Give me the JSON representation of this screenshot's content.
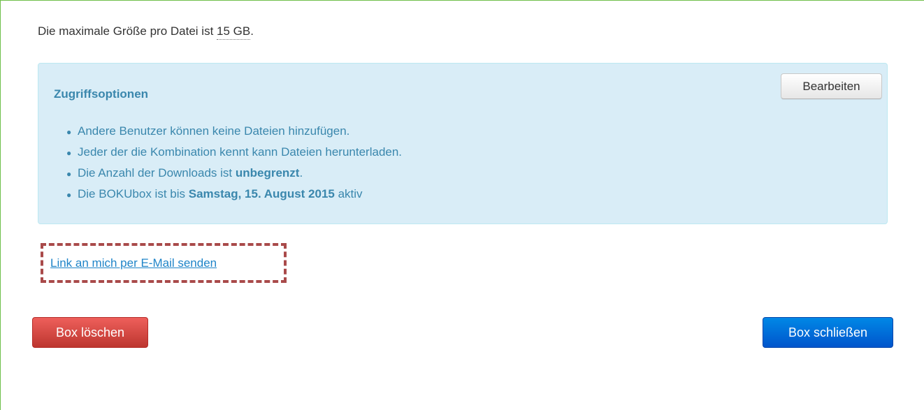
{
  "max_size": {
    "prefix": "Die maximale Größe pro Datei ist ",
    "value": "15 GB",
    "suffix": "."
  },
  "access_options": {
    "title": "Zugriffsoptionen",
    "edit_label": "Bearbeiten",
    "items": [
      {
        "text": "Andere Benutzer können keine Dateien hinzufügen."
      },
      {
        "text": "Jeder der die Kombination kennt kann Dateien herunterladen."
      },
      {
        "prefix": "Die Anzahl der Downloads ist ",
        "bold": "unbegrenzt",
        "suffix": "."
      },
      {
        "prefix": "Die BOKUbox ist bis ",
        "bold": "Samstag, 15. August 2015",
        "suffix": " aktiv"
      }
    ]
  },
  "email_link_label": "Link an mich per E-Mail senden",
  "buttons": {
    "delete_label": "Box löschen",
    "close_label": "Box schließen"
  },
  "colors": {
    "frame_border": "#6fbf4a",
    "info_background": "#d9edf7",
    "info_text": "#3a87ad",
    "link": "#1f84c8",
    "highlight_dashed": "#a94a4a",
    "danger": "#bd362f",
    "primary": "#0055cc"
  }
}
